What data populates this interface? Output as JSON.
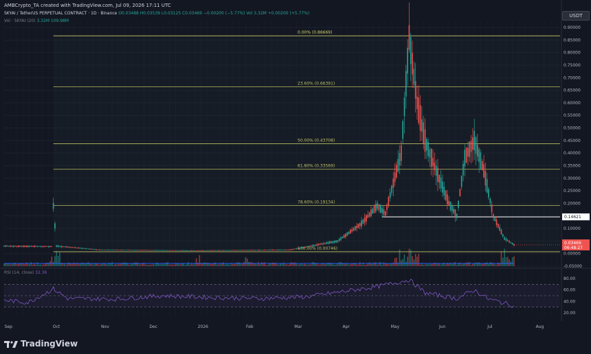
{
  "caption": "AMBCrypto_TA created with TradingView.com, Jul 09, 2026 17:11 UTC",
  "symbol_line": {
    "symbol": "SKYAI / TetherUS PERPETUAL CONTRACT · 1D · Binance",
    "ohlc": "O0.03488 H0.03539 L0.03125 C0.03469 −0.00200 (−5.77%)",
    "vol": "Vol 3.32M +0.00200 (+5.77%)"
  },
  "volume_legend": {
    "label": "Vol · SKYAI (20)",
    "value": "3.32M 109.98M"
  },
  "currency": "USDT",
  "chart_data": {
    "type": "candlestick",
    "x_tick_labels": [
      "Sep",
      "Oct",
      "Nov",
      "Dec",
      "2026",
      "Feb",
      "Mar",
      "Apr",
      "May",
      "Jun",
      "Jul",
      "Aug"
    ],
    "y_tick_labels": [
      "0.90000",
      "0.85000",
      "0.80000",
      "0.75000",
      "0.70000",
      "0.65000",
      "0.60000",
      "0.55000",
      "0.50000",
      "0.45000",
      "0.40000",
      "0.35000",
      "0.30000",
      "0.25000",
      "0.20000",
      "0.15000",
      "0.10000",
      "0.05000",
      "0.00000",
      "-0.05000"
    ],
    "ylim": [
      -0.05,
      0.9
    ],
    "fib_levels": [
      {
        "label": "0.00% (0.86669)",
        "value": 0.86669
      },
      {
        "label": "23.60% (0.66391)",
        "value": 0.66391
      },
      {
        "label": "50.00% (0.43708)",
        "value": 0.43708
      },
      {
        "label": "61.80% (0.33569)",
        "value": 0.33569
      },
      {
        "label": "78.60% (0.19134)",
        "value": 0.19134
      },
      {
        "label": "100.00% (0.00746)",
        "value": 0.00746
      }
    ],
    "horizontal_line": {
      "label": "0.14621",
      "value": 0.14621
    },
    "last_price": {
      "label": "0.03469",
      "countdown": "06:48:27",
      "value": 0.03469
    },
    "price_points": [
      {
        "day": 0,
        "value": 0.03
      },
      {
        "day": 30,
        "value": 0.028
      },
      {
        "day": 31,
        "value": 0.19
      },
      {
        "day": 33,
        "value": 0.03
      },
      {
        "day": 60,
        "value": 0.015
      },
      {
        "day": 120,
        "value": 0.012
      },
      {
        "day": 180,
        "value": 0.015
      },
      {
        "day": 210,
        "value": 0.05
      },
      {
        "day": 225,
        "value": 0.12
      },
      {
        "day": 235,
        "value": 0.19
      },
      {
        "day": 240,
        "value": 0.16
      },
      {
        "day": 250,
        "value": 0.4
      },
      {
        "day": 255,
        "value": 0.86
      },
      {
        "day": 260,
        "value": 0.6
      },
      {
        "day": 265,
        "value": 0.45
      },
      {
        "day": 272,
        "value": 0.33
      },
      {
        "day": 280,
        "value": 0.2
      },
      {
        "day": 285,
        "value": 0.15
      },
      {
        "day": 290,
        "value": 0.38
      },
      {
        "day": 296,
        "value": 0.45
      },
      {
        "day": 302,
        "value": 0.33
      },
      {
        "day": 308,
        "value": 0.15
      },
      {
        "day": 315,
        "value": 0.06
      },
      {
        "day": 321,
        "value": 0.035
      }
    ],
    "rsi": {
      "label": "RSI (14, close)",
      "value": "32.36",
      "y_tick_labels": [
        "80.00",
        "60.00",
        "40.00",
        "20.00"
      ],
      "ylim": [
        15,
        85
      ],
      "points": [
        {
          "day": 0,
          "value": 42
        },
        {
          "day": 15,
          "value": 38
        },
        {
          "day": 31,
          "value": 62
        },
        {
          "day": 40,
          "value": 45
        },
        {
          "day": 70,
          "value": 44
        },
        {
          "day": 100,
          "value": 50
        },
        {
          "day": 130,
          "value": 47
        },
        {
          "day": 160,
          "value": 45
        },
        {
          "day": 190,
          "value": 48
        },
        {
          "day": 215,
          "value": 58
        },
        {
          "day": 235,
          "value": 66
        },
        {
          "day": 255,
          "value": 78
        },
        {
          "day": 265,
          "value": 55
        },
        {
          "day": 275,
          "value": 50
        },
        {
          "day": 285,
          "value": 45
        },
        {
          "day": 296,
          "value": 60
        },
        {
          "day": 305,
          "value": 44
        },
        {
          "day": 315,
          "value": 37
        },
        {
          "day": 321,
          "value": 32.36
        }
      ]
    }
  },
  "brand": {
    "name": "TradingView"
  },
  "colors": {
    "background": "#131722",
    "up": "#26a69a",
    "down": "#ef5350",
    "fib": "#d6d46b",
    "rsi": "#7e57c2"
  }
}
